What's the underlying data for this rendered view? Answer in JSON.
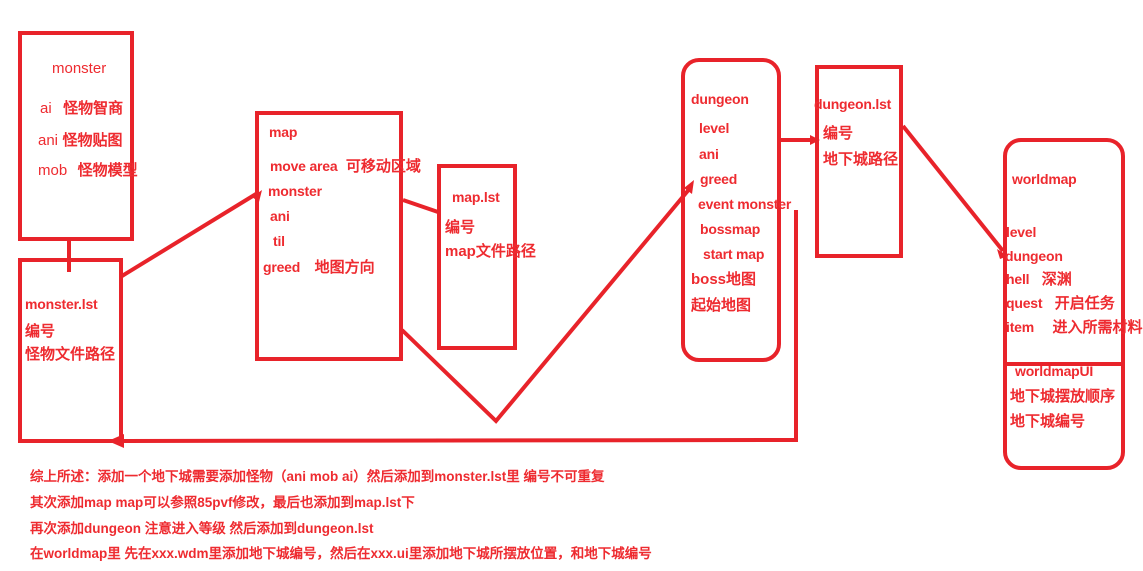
{
  "diagram": {
    "title": "Dungeon creation flow notes",
    "accent_color": "#ee2b30",
    "boxes": {
      "monster": {
        "title": "monster",
        "fields": [
          {
            "key": "ai",
            "note": "怪物智商"
          },
          {
            "key": "ani",
            "note": "怪物贴图"
          },
          {
            "key": "mob",
            "note": "怪物模型"
          }
        ]
      },
      "monster_lst": {
        "title": "monster.lst",
        "fields": [
          {
            "key": "编号",
            "note": ""
          },
          {
            "key": "怪物文件路径",
            "note": ""
          }
        ]
      },
      "map": {
        "title": "map",
        "fields": [
          {
            "key": "move area",
            "note": "可移动区域"
          },
          {
            "key": "monster",
            "note": ""
          },
          {
            "key": "ani",
            "note": ""
          },
          {
            "key": "til",
            "note": ""
          },
          {
            "key": "greed",
            "note": "地图方向"
          }
        ]
      },
      "map_lst": {
        "title": "map.lst",
        "fields": [
          {
            "key": "编号",
            "note": ""
          },
          {
            "key": "map文件路径",
            "note": ""
          }
        ]
      },
      "dungeon": {
        "title": "dungeon",
        "fields": [
          {
            "key": "level",
            "note": ""
          },
          {
            "key": "ani",
            "note": ""
          },
          {
            "key": "greed",
            "note": ""
          },
          {
            "key": "event monster",
            "note": ""
          },
          {
            "key": "bossmap",
            "note": ""
          },
          {
            "key": "start map",
            "note": ""
          },
          {
            "key": "boss地图",
            "note": ""
          },
          {
            "key": "起始地图",
            "note": ""
          }
        ]
      },
      "dungeon_lst": {
        "title": "dungeon.lst",
        "fields": [
          {
            "key": "编号",
            "note": ""
          },
          {
            "key": "地下城路径",
            "note": ""
          }
        ]
      },
      "worldmap": {
        "title": "worldmap",
        "fields": [
          {
            "key": "level",
            "note": ""
          },
          {
            "key": "dungeon",
            "note": ""
          },
          {
            "key": "hell",
            "note": "深渊"
          },
          {
            "key": "quest",
            "note": "开启任务"
          },
          {
            "key": "item",
            "note": "进入所需材料"
          }
        ],
        "sub_title": "worldmapUI",
        "sub_fields": [
          {
            "key": "地下城摆放顺序",
            "note": ""
          },
          {
            "key": "地下城编号",
            "note": ""
          }
        ]
      }
    },
    "footnotes": [
      "综上所述：添加一个地下城需要添加怪物（ani mob ai）然后添加到monster.lst里 编号不可重复",
      "其次添加map map可以参照85pvf修改，最后也添加到map.lst下",
      "再次添加dungeon 注意进入等级 然后添加到dungeon.lst",
      "在worldmap里 先在xxx.wdm里添加地下城编号，然后在xxx.ui里添加地下城所摆放位置，和地下城编号"
    ]
  }
}
